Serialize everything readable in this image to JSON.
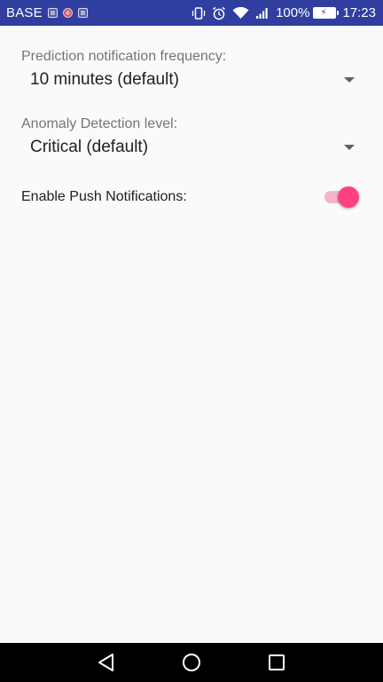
{
  "status_bar": {
    "carrier": "BASE",
    "notification_icons": [
      "app-notification-icon",
      "app-notification-icon",
      "app-notification-icon"
    ],
    "battery_percent": "100%",
    "time": "17:23",
    "background_color": "#303f9f"
  },
  "settings": {
    "prediction_frequency": {
      "label": "Prediction notification frequency:",
      "selected_value": "10 minutes (default)"
    },
    "anomaly_level": {
      "label": "Anomaly Detection level:",
      "selected_value": "Critical (default)"
    },
    "push_notifications": {
      "label": "Enable Push Notifications:",
      "enabled": true,
      "accent_color": "#ff4081"
    }
  },
  "nav_bar": {
    "buttons": [
      "back-icon",
      "home-icon",
      "recents-icon"
    ]
  }
}
